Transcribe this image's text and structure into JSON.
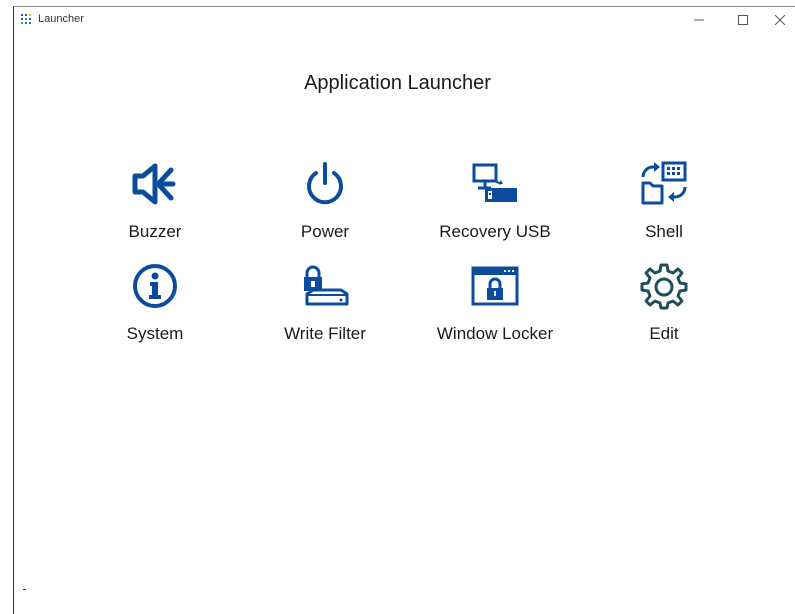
{
  "window": {
    "title": "Launcher",
    "minimize_symbol": "—",
    "maximize_symbol": "☐",
    "close_symbol": "✕"
  },
  "main": {
    "heading": "Application Launcher",
    "tiles": [
      {
        "label": "Buzzer",
        "icon": "speaker-icon"
      },
      {
        "label": "Power",
        "icon": "power-icon"
      },
      {
        "label": "Recovery USB",
        "icon": "usb-drive-icon"
      },
      {
        "label": "Shell",
        "icon": "shell-swap-icon"
      },
      {
        "label": "System",
        "icon": "info-icon"
      },
      {
        "label": "Write Filter",
        "icon": "locked-drive-icon"
      },
      {
        "label": "Window Locker",
        "icon": "window-lock-icon"
      },
      {
        "label": "Edit",
        "icon": "gear-icon"
      }
    ]
  },
  "colors": {
    "icon_blue": "#0b4c9c",
    "icon_teal": "#1f4e5a",
    "text": "#1a1a1a"
  }
}
